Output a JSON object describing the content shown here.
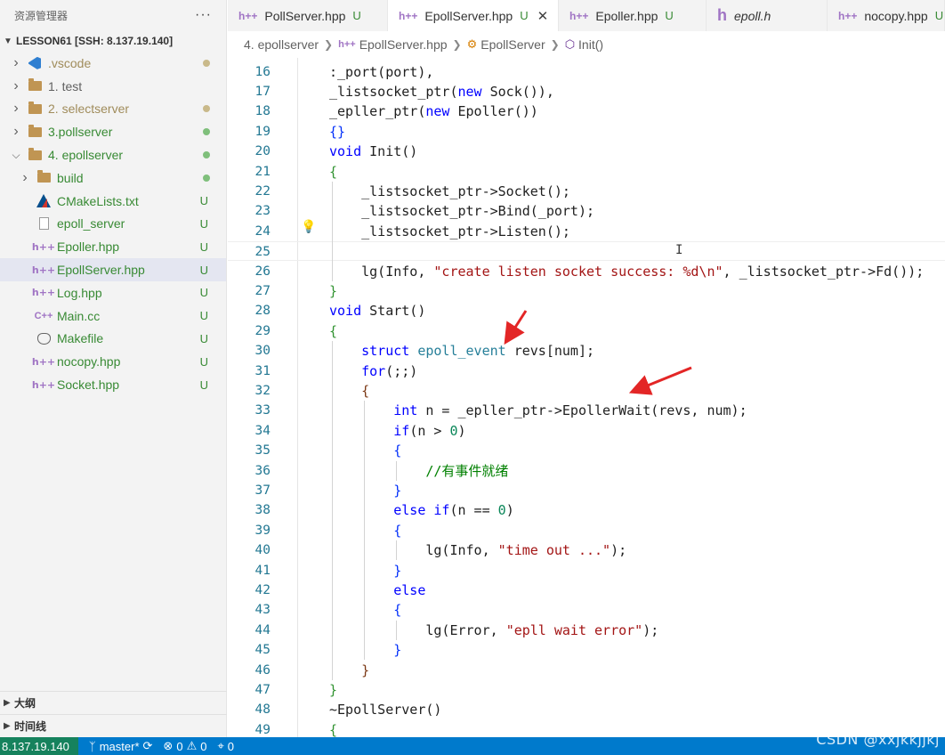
{
  "sidebar": {
    "title": "资源管理器",
    "more": "···",
    "root": "LESSON61 [SSH: 8.137.19.140]",
    "items": [
      {
        "label": ".vscode",
        "indent": 1,
        "type": "folder-vscode",
        "status": "dot",
        "color": "#a08c5b"
      },
      {
        "label": "1. test",
        "indent": 1,
        "type": "folder",
        "status": "",
        "color": "#616161"
      },
      {
        "label": "2. selectserver",
        "indent": 1,
        "type": "folder",
        "status": "dot",
        "color": "#a08c5b"
      },
      {
        "label": "3.pollserver",
        "indent": 1,
        "type": "folder",
        "status": "dot-green",
        "color": "#388a34"
      },
      {
        "label": "4. epollserver",
        "indent": 1,
        "type": "folder-open",
        "status": "dot-green",
        "color": "#388a34"
      },
      {
        "label": "build",
        "indent": 2,
        "type": "folder",
        "status": "dot-green",
        "color": "#388a34"
      },
      {
        "label": "CMakeLists.txt",
        "indent": 2,
        "type": "cmake",
        "status": "U",
        "color": "#388a34"
      },
      {
        "label": "epoll_server",
        "indent": 2,
        "type": "file",
        "status": "U",
        "color": "#388a34"
      },
      {
        "label": "Epoller.hpp",
        "indent": 2,
        "type": "hpp",
        "status": "U",
        "color": "#388a34"
      },
      {
        "label": "EpollServer.hpp",
        "indent": 2,
        "type": "hpp",
        "status": "U",
        "color": "#388a34",
        "selected": true
      },
      {
        "label": "Log.hpp",
        "indent": 2,
        "type": "hpp",
        "status": "U",
        "color": "#388a34"
      },
      {
        "label": "Main.cc",
        "indent": 2,
        "type": "cc",
        "status": "U",
        "color": "#388a34"
      },
      {
        "label": "Makefile",
        "indent": 2,
        "type": "gnu",
        "status": "U",
        "color": "#388a34"
      },
      {
        "label": "nocopy.hpp",
        "indent": 2,
        "type": "hpp",
        "status": "U",
        "color": "#388a34"
      },
      {
        "label": "Socket.hpp",
        "indent": 2,
        "type": "hpp",
        "status": "U",
        "color": "#388a34"
      }
    ],
    "outline": "大纲",
    "timeline": "时间线"
  },
  "tabs": [
    {
      "label": "PollServer.hpp",
      "icon": "h++",
      "modified": "U",
      "active": false,
      "italic": false
    },
    {
      "label": "EpollServer.hpp",
      "icon": "h++",
      "modified": "U",
      "active": true,
      "italic": false,
      "close": "✕"
    },
    {
      "label": "Epoller.hpp",
      "icon": "h++",
      "modified": "U",
      "active": false,
      "italic": false
    },
    {
      "label": "epoll.h",
      "icon": "h",
      "modified": "",
      "active": false,
      "italic": true
    },
    {
      "label": "nocopy.hpp",
      "icon": "h++",
      "modified": "U",
      "active": false,
      "italic": false
    }
  ],
  "breadcrumb": {
    "folder": "4. epollserver",
    "file": "EpollServer.hpp",
    "class": "EpollServer",
    "method": "Init()"
  },
  "code": {
    "first_line": 16,
    "lines": [
      [
        [
          ":_port(port),",
          ""
        ]
      ],
      [
        [
          "_listsocket_ptr(",
          ""
        ],
        [
          "new",
          "kw"
        ],
        [
          " Sock()),",
          ""
        ]
      ],
      [
        [
          "_epller_ptr(",
          ""
        ],
        [
          "new",
          "kw"
        ],
        [
          " Epoller())",
          ""
        ]
      ],
      [
        [
          "{}",
          "br1"
        ]
      ],
      [
        [
          "void",
          "kw"
        ],
        [
          " Init()",
          ""
        ]
      ],
      [
        [
          "{",
          "br2"
        ]
      ],
      [
        [
          "    _listsocket_ptr->Socket();",
          ""
        ]
      ],
      [
        [
          "    _listsocket_ptr->Bind(_port);",
          ""
        ]
      ],
      [
        [
          "    _listsocket_ptr->Listen();",
          ""
        ]
      ],
      [
        [
          "",
          ""
        ]
      ],
      [
        [
          "    lg(Info, ",
          ""
        ],
        [
          "\"create listen socket success: %d\\n\"",
          "str"
        ],
        [
          ", _listsocket_ptr->Fd());",
          ""
        ]
      ],
      [
        [
          "}",
          "br2"
        ]
      ],
      [
        [
          "void",
          "kw"
        ],
        [
          " Start()",
          ""
        ]
      ],
      [
        [
          "{",
          "br2"
        ]
      ],
      [
        [
          "    ",
          ""
        ],
        [
          "struct",
          "kw"
        ],
        [
          " ",
          ""
        ],
        [
          "epoll_event",
          "ty"
        ],
        [
          " revs[num];",
          ""
        ]
      ],
      [
        [
          "    ",
          ""
        ],
        [
          "for",
          "kw"
        ],
        [
          "(;;)",
          ""
        ]
      ],
      [
        [
          "    ",
          ""
        ],
        [
          "{",
          "br3"
        ]
      ],
      [
        [
          "        ",
          ""
        ],
        [
          "int",
          "kw"
        ],
        [
          " n = _epller_ptr->EpollerWait(revs, num);",
          ""
        ]
      ],
      [
        [
          "        ",
          ""
        ],
        [
          "if",
          "kw"
        ],
        [
          "(n > ",
          ""
        ],
        [
          "0",
          "num"
        ],
        [
          ")",
          ""
        ]
      ],
      [
        [
          "        ",
          ""
        ],
        [
          "{",
          "br1"
        ]
      ],
      [
        [
          "            ",
          ""
        ],
        [
          "//有事件就绪",
          "cm"
        ]
      ],
      [
        [
          "        ",
          ""
        ],
        [
          "}",
          "br1"
        ]
      ],
      [
        [
          "        ",
          ""
        ],
        [
          "else",
          "kw"
        ],
        [
          " ",
          ""
        ],
        [
          "if",
          "kw"
        ],
        [
          "(n == ",
          ""
        ],
        [
          "0",
          "num"
        ],
        [
          ")",
          ""
        ]
      ],
      [
        [
          "        ",
          ""
        ],
        [
          "{",
          "br1"
        ]
      ],
      [
        [
          "            lg(Info, ",
          ""
        ],
        [
          "\"time out ...\"",
          "str"
        ],
        [
          ");",
          ""
        ]
      ],
      [
        [
          "        ",
          ""
        ],
        [
          "}",
          "br1"
        ]
      ],
      [
        [
          "        ",
          ""
        ],
        [
          "else",
          "kw"
        ]
      ],
      [
        [
          "        ",
          ""
        ],
        [
          "{",
          "br1"
        ]
      ],
      [
        [
          "            lg(Error, ",
          ""
        ],
        [
          "\"epll wait error\"",
          "str"
        ],
        [
          ");",
          ""
        ]
      ],
      [
        [
          "        ",
          ""
        ],
        [
          "}",
          "br1"
        ]
      ],
      [
        [
          "    ",
          ""
        ],
        [
          "}",
          "br3"
        ]
      ],
      [
        [
          "}",
          "br2"
        ]
      ],
      [
        [
          "~EpollServer()",
          ""
        ]
      ],
      [
        [
          "{",
          "br2"
        ]
      ]
    ],
    "current_line": 25
  },
  "statusbar": {
    "remote": "8.137.19.140",
    "branch": "master*",
    "errors": "0",
    "warnings": "0",
    "ports": "0"
  },
  "watermark": "CSDN @xxjkkjjkj",
  "colors": {
    "accent": "#007acc",
    "remote": "#16825d",
    "untracked": "#388a34",
    "arrow": "#e32626"
  }
}
